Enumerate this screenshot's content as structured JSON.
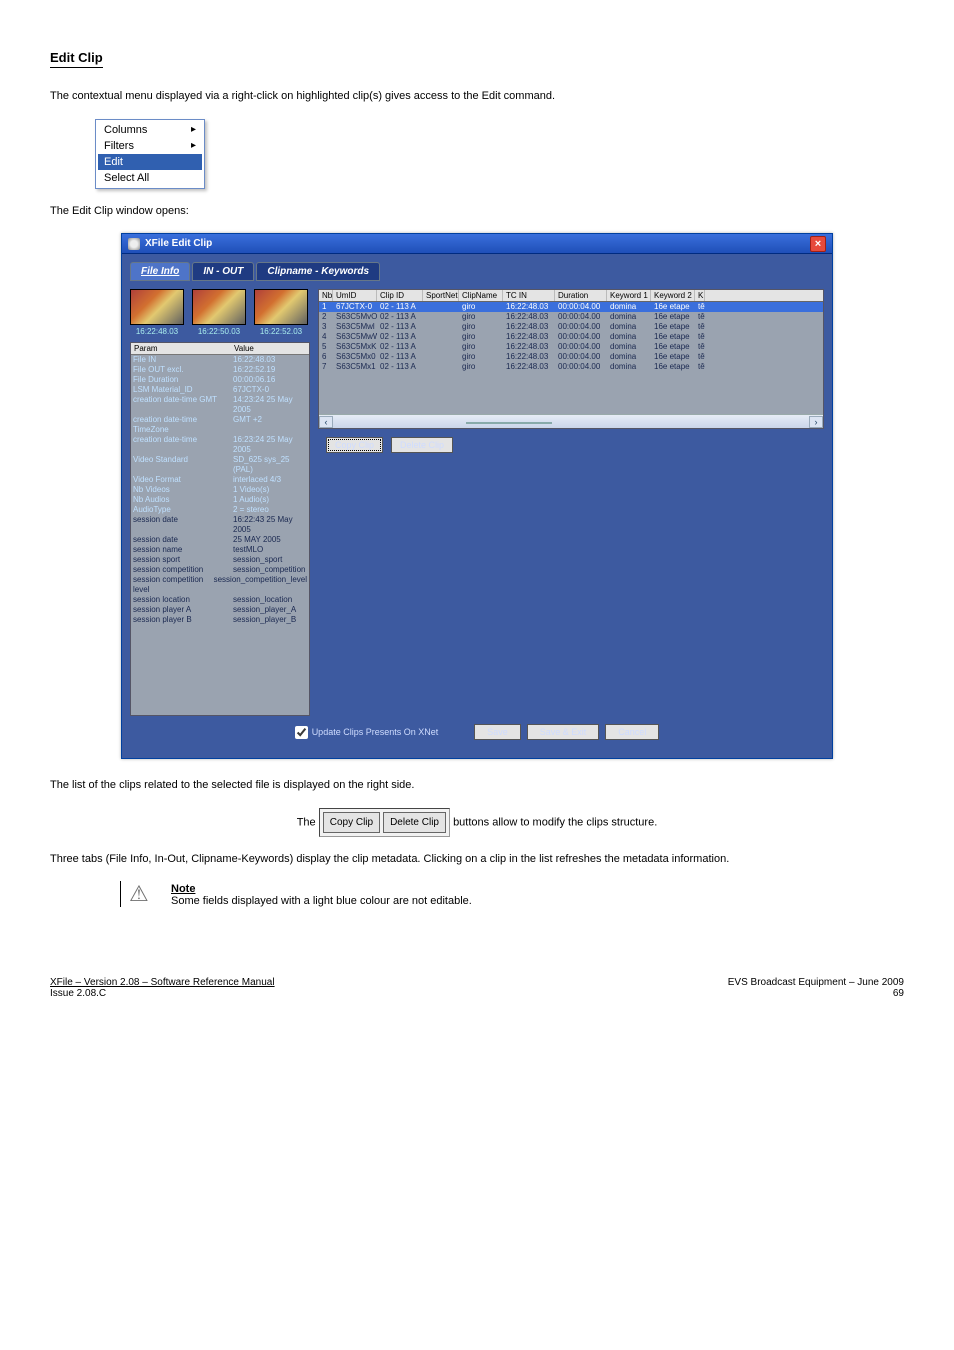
{
  "doc": {
    "title": "Edit Clip",
    "intro": "The contextual menu displayed via a right-click on highlighted clip(s) gives access to the Edit command.",
    "ctx_menu": {
      "items": [
        {
          "label": "Columns",
          "arrow": "▸"
        },
        {
          "label": "Filters",
          "arrow": "▸"
        },
        {
          "label": "Edit",
          "arrow": ""
        },
        {
          "label": "Select All",
          "arrow": ""
        }
      ],
      "selected_index": 2
    },
    "after_menu": "The Edit Clip window opens:"
  },
  "dialog": {
    "title": "XFile Edit Clip",
    "tabs": [
      "File Info",
      "IN - OUT",
      "Clipname - Keywords"
    ],
    "thumbs": [
      {
        "tc": "16:22:48.03"
      },
      {
        "tc": "16:22:50.03"
      },
      {
        "tc": "16:22:52.03"
      }
    ],
    "param_headers": [
      "Param",
      "Value"
    ],
    "params": [
      {
        "k": "File IN",
        "v": "16:22:48.03",
        "cls": "bluef"
      },
      {
        "k": "File OUT excl.",
        "v": "16:22:52.19",
        "cls": "bluef"
      },
      {
        "k": "File Duration",
        "v": "00:00:06.16",
        "cls": "bluef"
      },
      {
        "k": "LSM Material_ID",
        "v": "67JCTX-0",
        "cls": "bluef"
      },
      {
        "k": "creation date-time GMT",
        "v": "14:23:24   25 May 2005",
        "cls": "bluef"
      },
      {
        "k": "creation date-time TimeZone",
        "v": "GMT +2",
        "cls": "bluef"
      },
      {
        "k": "creation date-time",
        "v": "16:23:24   25 May 2005",
        "cls": "bluef"
      },
      {
        "k": "Video Standard",
        "v": "SD_625 sys_25 (PAL)",
        "cls": "bluef"
      },
      {
        "k": "Video Format",
        "v": "interlaced 4/3",
        "cls": "bluef"
      },
      {
        "k": "Nb Videos",
        "v": "1 Video(s)",
        "cls": "bluef"
      },
      {
        "k": "Nb Audios",
        "v": "1 Audio(s)",
        "cls": "bluef"
      },
      {
        "k": "AudioType",
        "v": "2 = stereo",
        "cls": "bluef"
      },
      {
        "k": "session date",
        "v": "16:22:43   25 May 2005",
        "cls": "dark"
      },
      {
        "k": "session date",
        "v": "25 MAY 2005",
        "cls": "dark"
      },
      {
        "k": "session name",
        "v": "testMLO",
        "cls": "dark"
      },
      {
        "k": "session sport",
        "v": "session_sport",
        "cls": "dark"
      },
      {
        "k": "session competition",
        "v": "session_competition",
        "cls": "dark"
      },
      {
        "k": "session competition level",
        "v": "session_competition_level",
        "cls": "dark"
      },
      {
        "k": "session location",
        "v": "session_location",
        "cls": "dark"
      },
      {
        "k": "session player A",
        "v": "session_player_A",
        "cls": "dark"
      },
      {
        "k": "session player B",
        "v": "session_player_B",
        "cls": "dark"
      }
    ],
    "grid": {
      "columns": [
        "Nb",
        "UmID",
        "Clip ID",
        "SportNet",
        "ClipName",
        "TC IN",
        "Duration",
        "Keyword 1",
        "Keyword 2",
        "K"
      ],
      "rows": [
        {
          "sel": true,
          "cells": [
            "1",
            "67JCTX-0",
            "02 - 113 A",
            "",
            "giro",
            "16:22:48.03",
            "00:00:04.00",
            "domina",
            "16e etape",
            "têt"
          ]
        },
        {
          "sel": false,
          "cells": [
            "2",
            "S63C5MvO",
            "02 - 113 A",
            "",
            "giro",
            "16:22:48.03",
            "00:00:04.00",
            "domina",
            "16e etape",
            "têt"
          ]
        },
        {
          "sel": false,
          "cells": [
            "3",
            "S63C5Mwl",
            "02 - 113 A",
            "",
            "giro",
            "16:22:48.03",
            "00:00:04.00",
            "domina",
            "16e etape",
            "têt"
          ]
        },
        {
          "sel": false,
          "cells": [
            "4",
            "S63C5MwW",
            "02 - 113 A",
            "",
            "giro",
            "16:22:48.03",
            "00:00:04.00",
            "domina",
            "16e etape",
            "têt"
          ]
        },
        {
          "sel": false,
          "cells": [
            "5",
            "S63C5MxK",
            "02 - 113 A",
            "",
            "giro",
            "16:22:48.03",
            "00:00:04.00",
            "domina",
            "16e etape",
            "têt"
          ]
        },
        {
          "sel": false,
          "cells": [
            "6",
            "S63C5Mx0",
            "02 - 113 A",
            "",
            "giro",
            "16:22:48.03",
            "00:00:04.00",
            "domina",
            "16e etape",
            "têt"
          ]
        },
        {
          "sel": false,
          "cells": [
            "7",
            "S63C5Mx1",
            "02 - 113 A",
            "",
            "giro",
            "16:22:48.03",
            "00:00:04.00",
            "domina",
            "16e etape",
            "têt"
          ]
        }
      ]
    },
    "right_buttons": {
      "copy": "Copy Clip",
      "delete": "Delete Clip"
    },
    "footer": {
      "checkbox": "Update Clips Presents On XNet",
      "save": "Save",
      "save_exit": "Save & Exit",
      "cancel": "Cancel"
    }
  },
  "after_dialog_1": "The list of the clips related to the selected file is displayed on the right side.",
  "inline_btn_row": {
    "prefix": "The ",
    "suffix": " buttons allow to modify the clips structure.",
    "copy": "Copy Clip",
    "delete": "Delete Clip"
  },
  "after_dialog_2": "Three tabs (File Info, In-Out, Clipname-Keywords) display the clip metadata. Clicking on a clip in the list refreshes the metadata information.",
  "note": {
    "label": "Note",
    "text": "Some fields displayed with a light blue colour are not editable."
  },
  "footer": {
    "left": "XFile – Version 2.08 – Software Reference Manual",
    "left_sub": "Issue 2.08.C",
    "right": "EVS Broadcast Equipment – June 2009",
    "pagenum": "69"
  }
}
